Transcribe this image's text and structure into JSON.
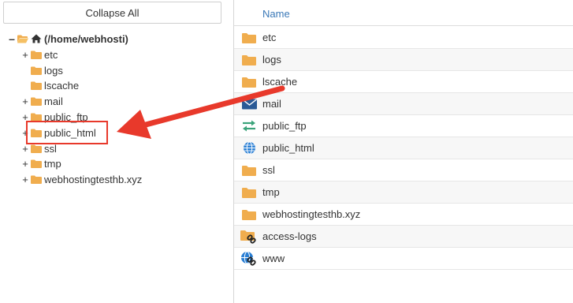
{
  "toolbar": {
    "collapse_label": "Collapse All"
  },
  "tree": {
    "root_label": "(/home/webhosti)",
    "items": [
      {
        "label": "etc",
        "toggle": "+"
      },
      {
        "label": "logs",
        "toggle": ""
      },
      {
        "label": "lscache",
        "toggle": ""
      },
      {
        "label": "mail",
        "toggle": "+"
      },
      {
        "label": "public_ftp",
        "toggle": "+"
      },
      {
        "label": "public_html",
        "toggle": "+"
      },
      {
        "label": "ssl",
        "toggle": "+"
      },
      {
        "label": "tmp",
        "toggle": "+"
      },
      {
        "label": "webhostingtesthb.xyz",
        "toggle": "+"
      }
    ]
  },
  "file_list": {
    "column_header": "Name",
    "rows": [
      {
        "name": "etc",
        "icon": "folder-icon"
      },
      {
        "name": "logs",
        "icon": "folder-icon"
      },
      {
        "name": "lscache",
        "icon": "folder-icon"
      },
      {
        "name": "mail",
        "icon": "envelope-icon"
      },
      {
        "name": "public_ftp",
        "icon": "transfer-arrows-icon"
      },
      {
        "name": "public_html",
        "icon": "globe-icon"
      },
      {
        "name": "ssl",
        "icon": "folder-icon"
      },
      {
        "name": "tmp",
        "icon": "folder-icon"
      },
      {
        "name": "webhostingtesthb.xyz",
        "icon": "folder-icon"
      },
      {
        "name": "access-logs",
        "icon": "folder-link-icon"
      },
      {
        "name": "www",
        "icon": "globe-link-icon"
      }
    ]
  },
  "colors": {
    "folder": "#f0ad4e",
    "header_text": "#3a78b7",
    "highlight": "#e8392b",
    "mail": "#2a5a96",
    "ftp": "#3aa37a",
    "globe": "#2a7fd4"
  }
}
